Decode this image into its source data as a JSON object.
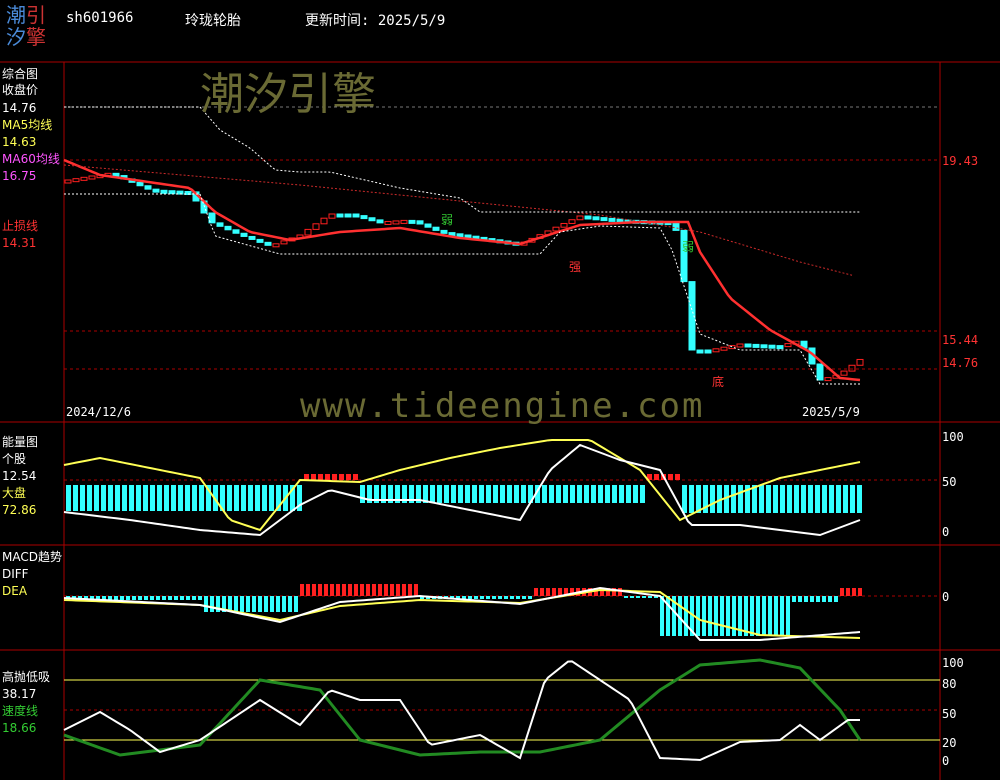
{
  "header": {
    "logo_chars": [
      "潮",
      "引",
      "汐",
      "擎"
    ],
    "code": "sh601966",
    "name": "玲珑轮胎",
    "update_label": "更新时间: 2025/5/9"
  },
  "watermark": {
    "cn": "潮汐引擎",
    "url": "www.tideengine.com"
  },
  "colors": {
    "bg": "#000000",
    "up": "#ff2020",
    "down": "#33ffff",
    "ma5": "#ffffff",
    "ma60": "#ff3030",
    "yellow": "#ffff55",
    "green": "#228b22",
    "axis": "#aa0000"
  },
  "panel_main": {
    "title": "综合图",
    "close_label": "收盘价",
    "close_value": "14.76",
    "ma5_label": "MA5均线",
    "ma5_value": "14.63",
    "ma60_label": "MA60均线",
    "ma60_value": "16.75",
    "stop_label": "止损线",
    "stop_value": "14.31",
    "date_start": "2024/12/6",
    "date_end": "2025/5/9",
    "right_ticks": [
      "19.43",
      "15.44",
      "14.76"
    ],
    "annotations": {
      "weak1": "弱",
      "strong": "强",
      "weak2": "弱",
      "bottom": "底"
    }
  },
  "panel_energy": {
    "title": "能量图",
    "stock_label": "个股",
    "stock_value": "12.54",
    "market_label": "大盘",
    "market_value": "72.86",
    "ticks": [
      "100",
      "50",
      "0"
    ]
  },
  "panel_macd": {
    "title": "MACD趋势",
    "diff_label": "DIFF",
    "dea_label": "DEA",
    "ticks": [
      "0"
    ]
  },
  "panel_osc": {
    "title": "高抛低吸",
    "value": "38.17",
    "speed_label": "速度线",
    "speed_value": "18.66",
    "ticks": [
      "100",
      "80",
      "50",
      "20",
      "0"
    ]
  },
  "chart_data": {
    "type": "candlestick",
    "x_start": "2024/12/6",
    "x_end": "2025/5/9",
    "close_last": 14.76,
    "ma5_last": 14.63,
    "ma60_last": 16.75,
    "stop_loss": 14.31,
    "right_axis": [
      19.43,
      15.44,
      14.76
    ]
  }
}
